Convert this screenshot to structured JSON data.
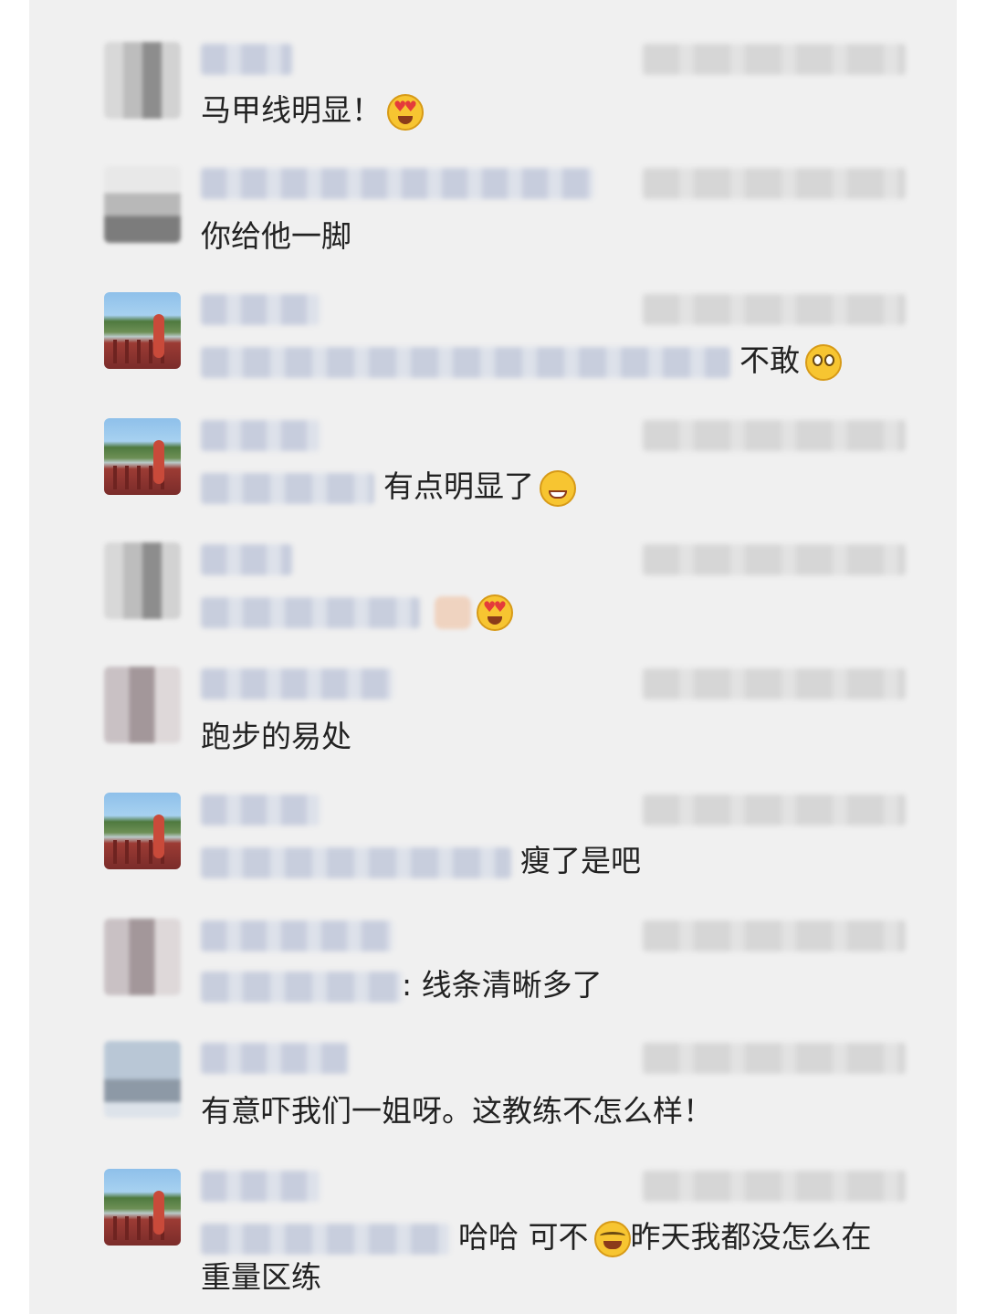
{
  "comments": [
    {
      "text": "马甲线明显！",
      "emoji": "heart-eyes-icon"
    },
    {
      "text": "你给他一脚"
    },
    {
      "text": "不敢",
      "emoji": "flushed-face-icon"
    },
    {
      "text": "有点明显了",
      "emoji": "grin-icon"
    },
    {
      "text": "",
      "emoji": "heart-eyes-icon"
    },
    {
      "text": "跑步的易处"
    },
    {
      "text": "瘦了是吧"
    },
    {
      "text": ": 线条清晰多了"
    },
    {
      "text": "有意吓我们一姐呀。这教练不怎么样！"
    },
    {
      "text_before": "哈哈 可不",
      "text_after": "昨天我都没怎么在",
      "text_line2": "重量区练",
      "emoji": "crying-laughing-icon"
    }
  ]
}
